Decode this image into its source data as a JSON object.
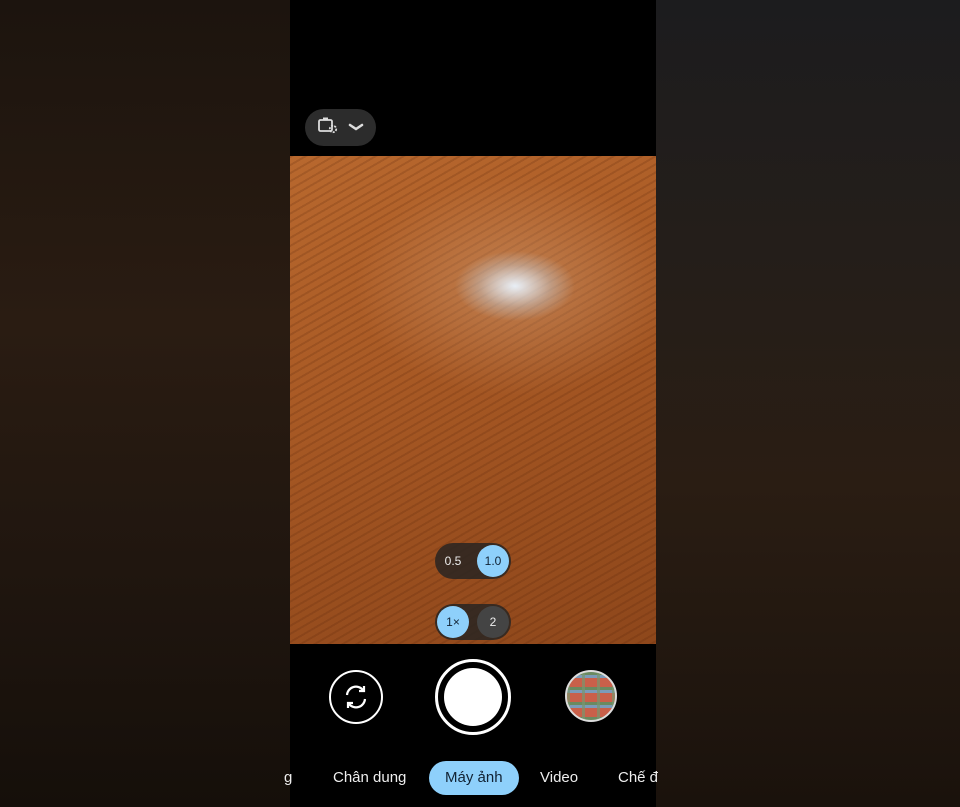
{
  "top": {
    "settings_icon": "camera-settings-icon",
    "dropdown_icon": "chevron-down-icon"
  },
  "lens": {
    "options": [
      "0.5",
      "1.0"
    ],
    "selected": "1.0"
  },
  "zoom": {
    "options": [
      "1×",
      "2"
    ],
    "selected": "1×"
  },
  "controls": {
    "flip_icon": "flip-camera-icon",
    "gallery_icon": "gallery-thumbnail"
  },
  "modes": {
    "items": [
      "g",
      "Chân dung",
      "Máy ảnh",
      "Video",
      "Chế đ"
    ],
    "selected": "Máy ảnh"
  },
  "colors": {
    "accent": "#8ed0fb"
  }
}
